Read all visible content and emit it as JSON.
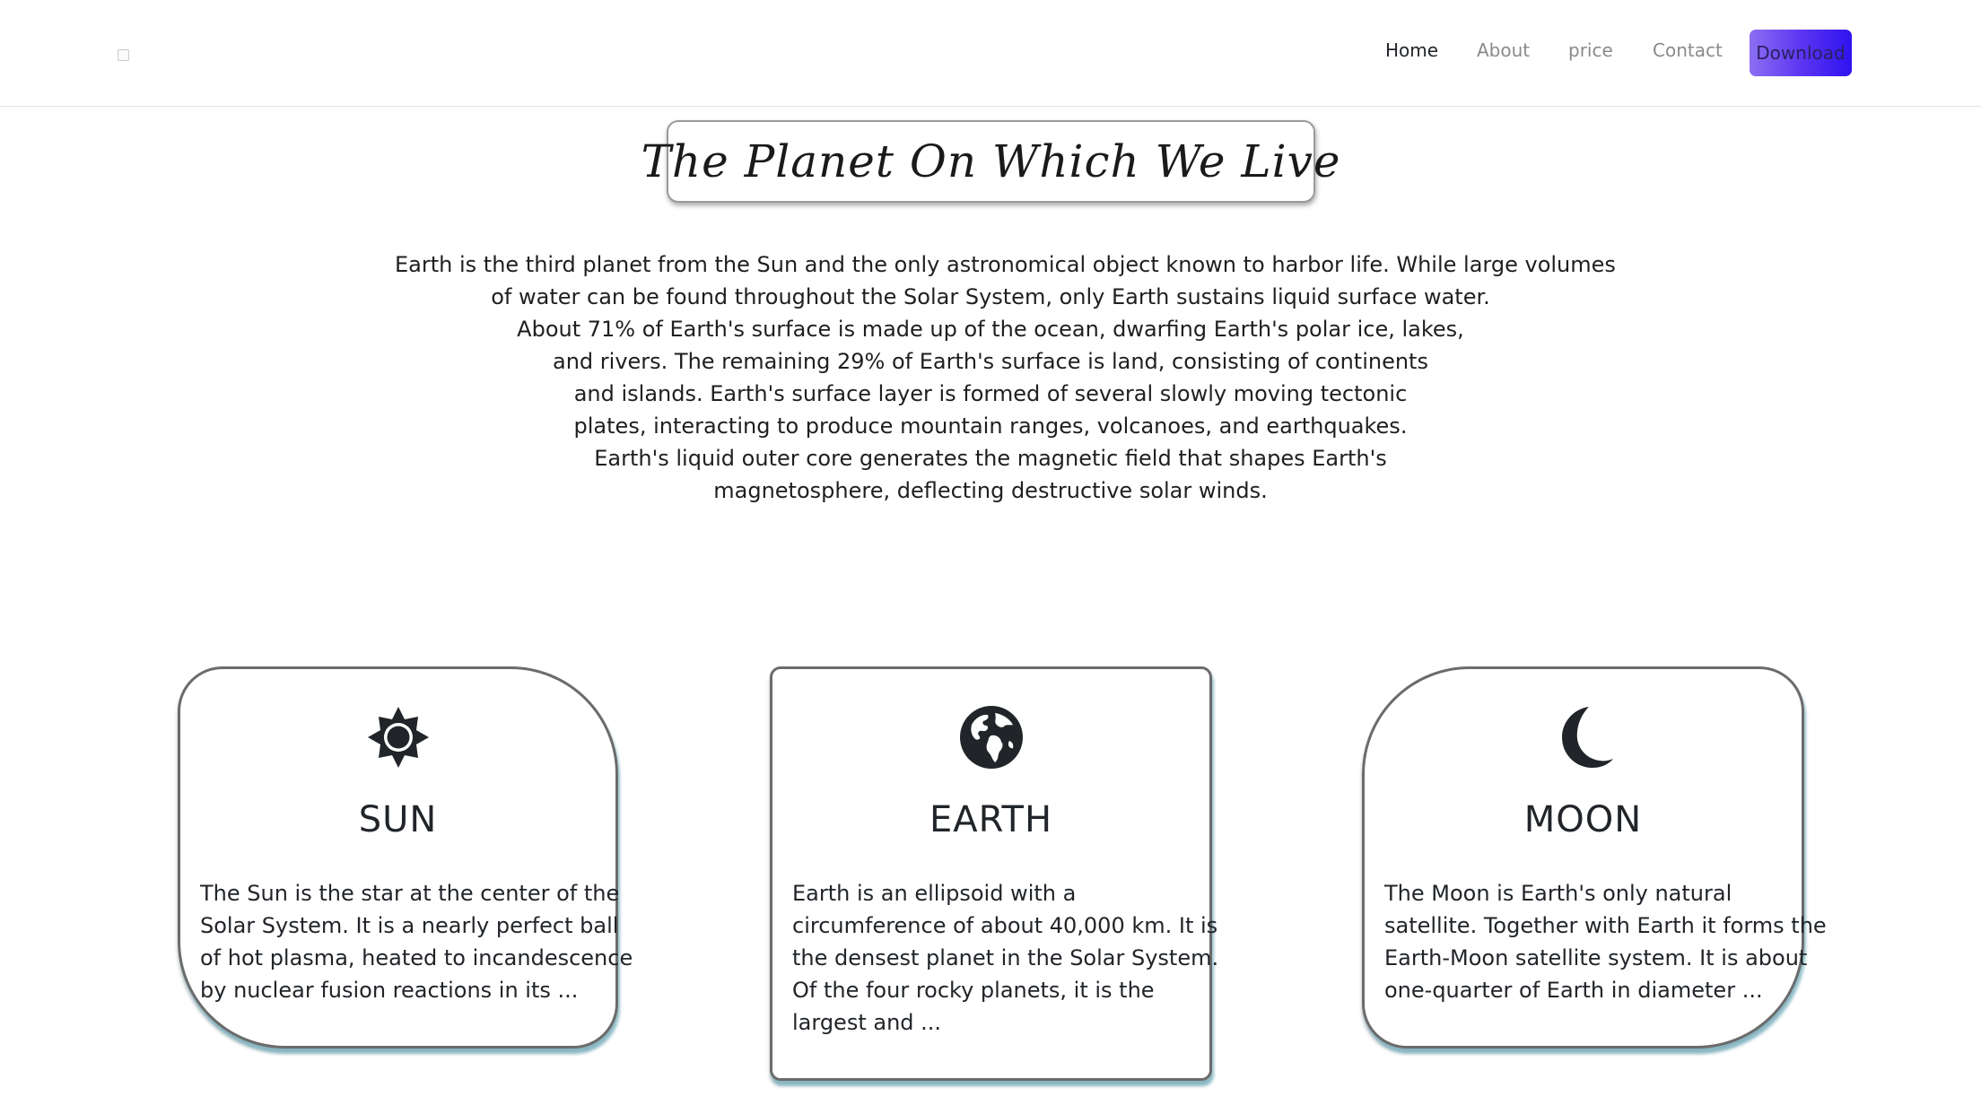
{
  "nav": {
    "brand_icon": "broken-image-icon",
    "links": [
      "Home",
      "About",
      "price",
      "Contact"
    ],
    "download_label": "Download",
    "accent_gradient": [
      "#8b6ff2",
      "#2f12ef"
    ]
  },
  "hero": {
    "title": "The Planet On Which We Live",
    "intro_lines": [
      "Earth is the third planet from the Sun and the only astronomical object known to harbor life. While large volumes",
      "of water can be found throughout the Solar System, only Earth sustains liquid surface water.",
      "About 71% of Earth's surface is made up of the ocean, dwarfing Earth's polar ice, lakes,",
      "and rivers. The remaining 29% of Earth's surface is land, consisting of continents",
      "and islands. Earth's surface layer is formed of several slowly moving tectonic",
      "plates, interacting to produce mountain ranges, volcanoes, and earthquakes.",
      "Earth's liquid outer core generates the magnetic field that shapes Earth's",
      "magnetosphere, deflecting destructive solar winds."
    ]
  },
  "cards": [
    {
      "icon": "sun-icon",
      "title": "SUN",
      "lines": [
        "The Sun is the star at the center of the",
        "Solar System. It is a nearly perfect ball",
        "of hot plasma, heated to incandescence",
        "by nuclear fusion reactions in its ..."
      ]
    },
    {
      "icon": "globe-icon",
      "title": "EARTH",
      "lines": [
        "Earth is an ellipsoid with a",
        "circumference of about 40,000 km. It is",
        "the densest planet in the Solar System.",
        "Of the four rocky planets, it is the",
        "largest and ..."
      ]
    },
    {
      "icon": "moon-icon",
      "title": "MOON",
      "lines": [
        "The Moon is Earth's only natural",
        "satellite. Together with Earth it forms the",
        "Earth-Moon satellite system. It is about",
        "one-quarter of Earth in diameter ..."
      ]
    }
  ],
  "colors": {
    "card_border": "#6b6b6b",
    "card_shadow": "#5aaabe",
    "text": "#212529",
    "nav_inactive": "#8a8a8a"
  }
}
